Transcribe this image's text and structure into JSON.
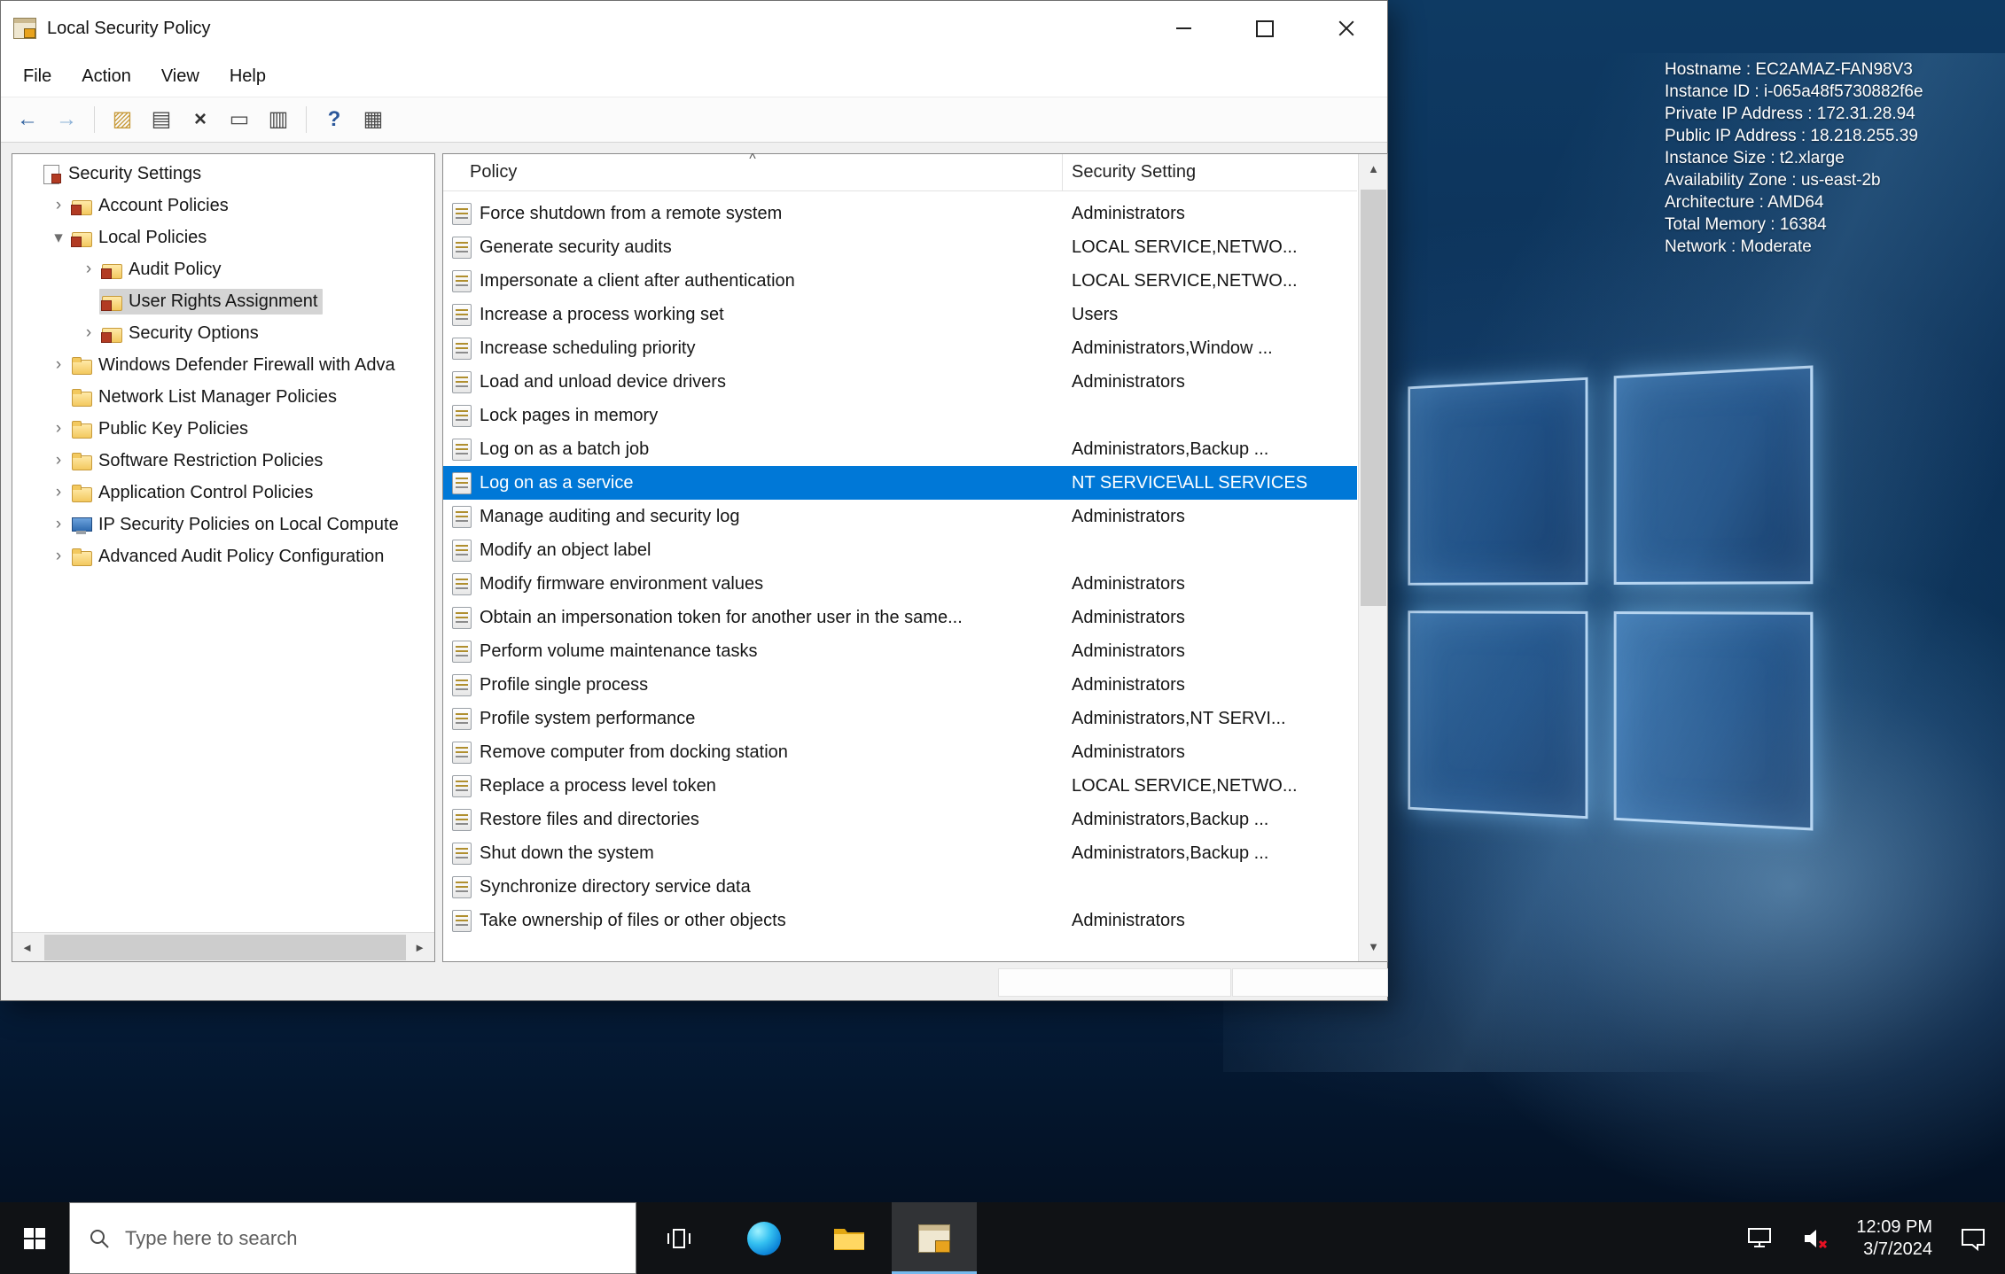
{
  "colors": {
    "accent": "#0078d7",
    "tree_selection": "#d4d4d4",
    "taskbar": "#101215"
  },
  "window": {
    "title": "Local Security Policy",
    "menus": [
      "File",
      "Action",
      "View",
      "Help"
    ],
    "toolbar": [
      {
        "name": "back-icon",
        "glyph": "←",
        "color": "#2c5f9e"
      },
      {
        "name": "forward-icon",
        "glyph": "→",
        "color": "#8ab0d6"
      },
      {
        "name": "separator"
      },
      {
        "name": "up-icon",
        "glyph": "▨",
        "color": "#c79a3a"
      },
      {
        "name": "show-console-tree-icon",
        "glyph": "▤",
        "color": "#4a4a4a"
      },
      {
        "name": "delete-icon",
        "glyph": "×",
        "color": "#333333"
      },
      {
        "name": "properties-icon",
        "glyph": "▭",
        "color": "#4a4a4a"
      },
      {
        "name": "export-list-icon",
        "glyph": "▥",
        "color": "#4a4a4a"
      },
      {
        "name": "separator"
      },
      {
        "name": "help-icon",
        "glyph": "?",
        "color": "#2b579a"
      },
      {
        "name": "view-menu-icon",
        "glyph": "▦",
        "color": "#4a4a4a"
      }
    ],
    "tree": {
      "items": [
        {
          "label": "Security Settings",
          "depth": 0,
          "expander": "",
          "icon": "root",
          "selected": false
        },
        {
          "label": "Account Policies",
          "depth": 1,
          "expander": ">",
          "icon": "folder-policy",
          "selected": false
        },
        {
          "label": "Local Policies",
          "depth": 1,
          "expander": "v",
          "icon": "folder-policy",
          "selected": false
        },
        {
          "label": "Audit Policy",
          "depth": 2,
          "expander": ">",
          "icon": "folder-policy",
          "selected": false
        },
        {
          "label": "User Rights Assignment",
          "depth": 2,
          "expander": "",
          "icon": "folder-policy",
          "selected": true
        },
        {
          "label": "Security Options",
          "depth": 2,
          "expander": ">",
          "icon": "folder-policy",
          "selected": false
        },
        {
          "label": "Windows Defender Firewall with Adva",
          "depth": 1,
          "expander": ">",
          "icon": "folder",
          "selected": false
        },
        {
          "label": "Network List Manager Policies",
          "depth": 1,
          "expander": "",
          "icon": "folder",
          "selected": false
        },
        {
          "label": "Public Key Policies",
          "depth": 1,
          "expander": ">",
          "icon": "folder",
          "selected": false
        },
        {
          "label": "Software Restriction Policies",
          "depth": 1,
          "expander": ">",
          "icon": "folder",
          "selected": false
        },
        {
          "label": "Application Control Policies",
          "depth": 1,
          "expander": ">",
          "icon": "folder",
          "selected": false
        },
        {
          "label": "IP Security Policies on Local Compute",
          "depth": 1,
          "expander": ">",
          "icon": "computer",
          "selected": false
        },
        {
          "label": "Advanced Audit Policy Configuration",
          "depth": 1,
          "expander": ">",
          "icon": "folder",
          "selected": false
        }
      ]
    },
    "list": {
      "columns": [
        "Policy",
        "Security Setting"
      ],
      "sort_indicator": "^",
      "selected_index": 8,
      "rows": [
        {
          "policy": "Force shutdown from a remote system",
          "setting": "Administrators"
        },
        {
          "policy": "Generate security audits",
          "setting": "LOCAL SERVICE,NETWO..."
        },
        {
          "policy": "Impersonate a client after authentication",
          "setting": "LOCAL SERVICE,NETWO..."
        },
        {
          "policy": "Increase a process working set",
          "setting": "Users"
        },
        {
          "policy": "Increase scheduling priority",
          "setting": "Administrators,Window ..."
        },
        {
          "policy": "Load and unload device drivers",
          "setting": "Administrators"
        },
        {
          "policy": "Lock pages in memory",
          "setting": ""
        },
        {
          "policy": "Log on as a batch job",
          "setting": "Administrators,Backup ..."
        },
        {
          "policy": "Log on as a service",
          "setting": "NT SERVICE\\ALL SERVICES"
        },
        {
          "policy": "Manage auditing and security log",
          "setting": "Administrators"
        },
        {
          "policy": "Modify an object label",
          "setting": ""
        },
        {
          "policy": "Modify firmware environment values",
          "setting": "Administrators"
        },
        {
          "policy": "Obtain an impersonation token for another user in the same...",
          "setting": "Administrators"
        },
        {
          "policy": "Perform volume maintenance tasks",
          "setting": "Administrators"
        },
        {
          "policy": "Profile single process",
          "setting": "Administrators"
        },
        {
          "policy": "Profile system performance",
          "setting": "Administrators,NT SERVI..."
        },
        {
          "policy": "Remove computer from docking station",
          "setting": "Administrators"
        },
        {
          "policy": "Replace a process level token",
          "setting": "LOCAL SERVICE,NETWO..."
        },
        {
          "policy": "Restore files and directories",
          "setting": "Administrators,Backup ..."
        },
        {
          "policy": "Shut down the system",
          "setting": "Administrators,Backup ..."
        },
        {
          "policy": "Synchronize directory service data",
          "setting": ""
        },
        {
          "policy": "Take ownership of files or other objects",
          "setting": "Administrators"
        }
      ]
    }
  },
  "desktop": {
    "info_lines": [
      "Hostname : EC2AMAZ-FAN98V3",
      "Instance ID : i-065a48f5730882f6e",
      "Private IP Address : 172.31.28.94",
      "Public IP Address : 18.218.255.39",
      "Instance Size : t2.xlarge",
      "Availability Zone : us-east-2b",
      "Architecture : AMD64",
      "Total Memory : 16384",
      "Network : Moderate"
    ]
  },
  "taskbar": {
    "search_placeholder": "Type here to search",
    "time": "12:09 PM",
    "date": "3/7/2024"
  }
}
